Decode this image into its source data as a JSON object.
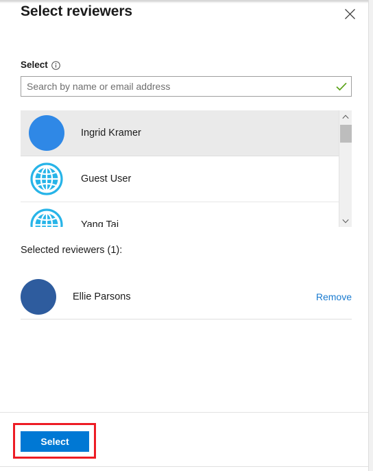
{
  "dialog": {
    "title": "Select reviewers",
    "close_icon": "close-icon"
  },
  "field": {
    "label": "Select",
    "info_icon": "info-circle-icon",
    "search_placeholder": "Search by name or email address",
    "search_value": "",
    "validation_icon": "green-checkmark-icon",
    "validation_color": "#5aa216"
  },
  "results": {
    "scrollbar": {
      "up_arrow": "chevron-up-icon",
      "down_arrow": "chevron-down-icon"
    },
    "items": [
      {
        "name": "Ingrid Kramer",
        "avatar_type": "photo",
        "avatar_color": "#2f88e6",
        "highlighted": true
      },
      {
        "name": "Guest User",
        "avatar_type": "globe",
        "avatar_color": "#27b4e8",
        "highlighted": false
      },
      {
        "name": "Yang Tai",
        "avatar_type": "globe",
        "avatar_color": "#27b4e8",
        "highlighted": false
      }
    ]
  },
  "selected": {
    "heading": "Selected reviewers (1):",
    "items": [
      {
        "name": "Ellie Parsons",
        "avatar_type": "photo",
        "avatar_color": "#2e5c9e",
        "remove_label": "Remove"
      }
    ]
  },
  "footer": {
    "select_label": "Select",
    "select_color": "#0078d4",
    "highlight_color": "#ed1c24"
  }
}
